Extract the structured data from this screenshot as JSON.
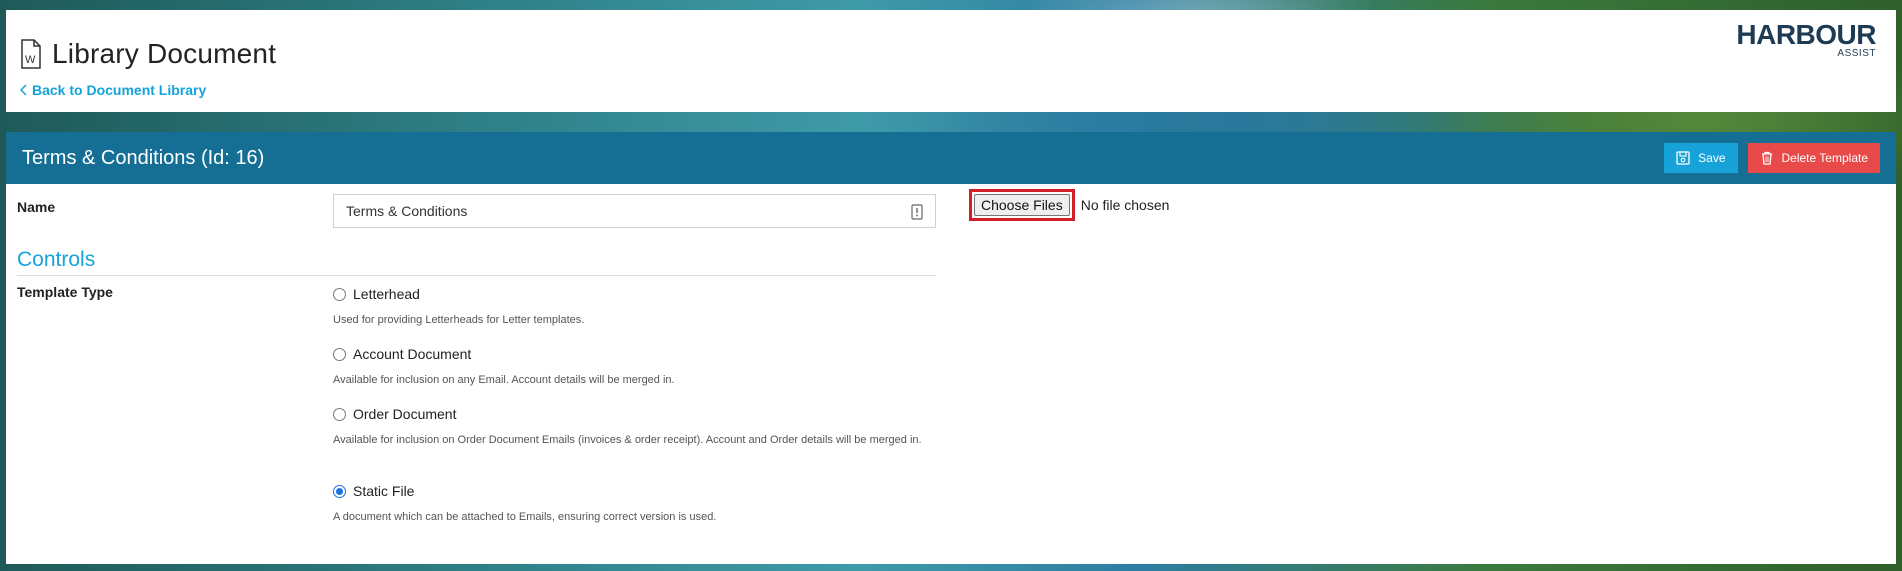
{
  "header": {
    "page_title": "Library Document",
    "back_link": "Back to Document Library",
    "logo_main": "HARBOUR",
    "logo_sub": "ASSIST"
  },
  "panel": {
    "title": "Terms & Conditions (Id: 16)",
    "save_label": "Save",
    "delete_label": "Delete Template"
  },
  "form": {
    "name_label": "Name",
    "name_value": "Terms & Conditions",
    "controls_heading": "Controls",
    "template_type_label": "Template Type",
    "options": [
      {
        "label": "Letterhead",
        "description": "Used for providing Letterheads for Letter templates.",
        "checked": false
      },
      {
        "label": "Account Document",
        "description": "Available for inclusion on any Email. Account details will be merged in.",
        "checked": false
      },
      {
        "label": "Order Document",
        "description": "Available for inclusion on Order Document Emails (invoices & order receipt). Account and Order details will be merged in.",
        "checked": false
      },
      {
        "label": "Static File",
        "description": "A document which can be attached to Emails, ensuring correct version is used.",
        "checked": true
      }
    ]
  },
  "file_upload": {
    "button_label": "Choose Files",
    "status": "No file chosen"
  },
  "colors": {
    "header_bar": "#156e94",
    "accent": "#17a2d9",
    "danger": "#e84a4a",
    "highlight": "#d01f26"
  }
}
